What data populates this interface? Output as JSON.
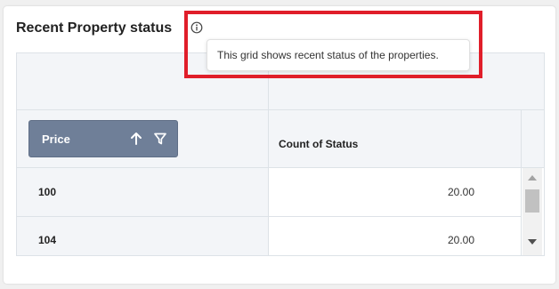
{
  "widget": {
    "title": "Recent Property status",
    "info_icon": "info-circle-icon",
    "tooltip_text": "This grid shows recent status of the properties."
  },
  "grid": {
    "row_header": {
      "label": "Price",
      "sort_icon": "arrow-up-icon",
      "filter_icon": "filter-icon"
    },
    "value_header": "Count of Status",
    "rows": [
      {
        "price": "100",
        "count": "20.00"
      },
      {
        "price": "104",
        "count": "20.00"
      }
    ]
  },
  "colors": {
    "chip_bg": "#6f7f98",
    "header_bg": "#f3f5f8",
    "highlight": "#e01e2a"
  }
}
